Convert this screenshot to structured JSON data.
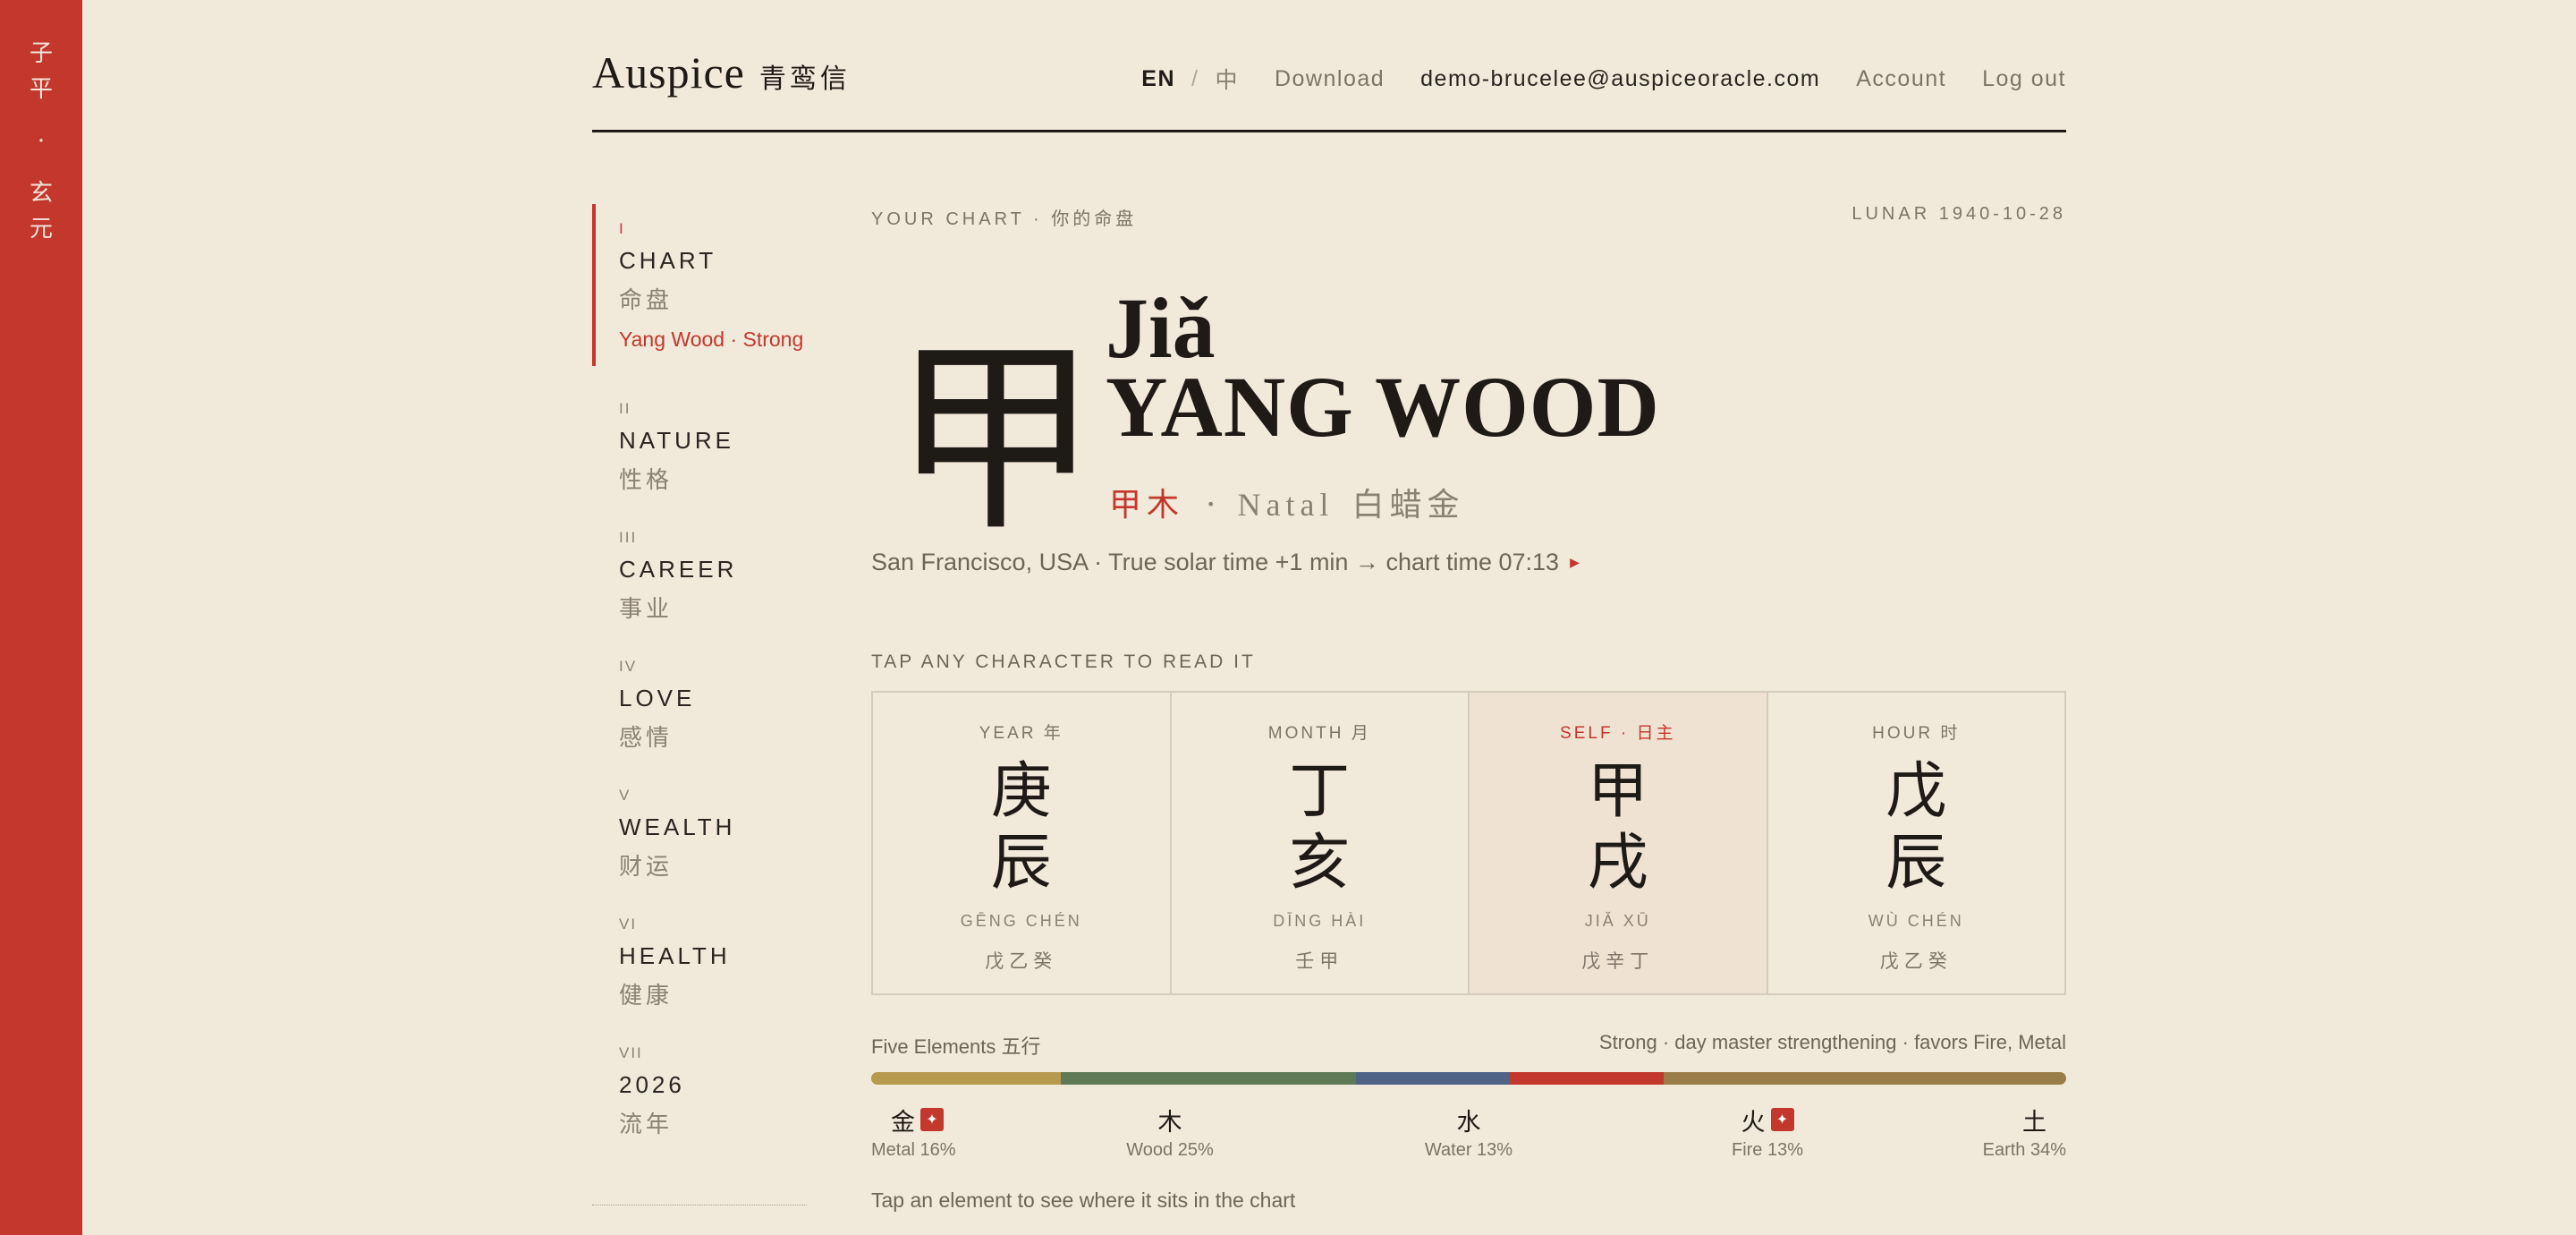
{
  "rail": {
    "chars": [
      "子",
      "平",
      "·",
      "玄",
      "元"
    ]
  },
  "header": {
    "logo_en": "Auspice",
    "logo_zh": "青鸾信",
    "lang_en": "EN",
    "lang_sep": "/",
    "lang_zh": "中",
    "download": "Download",
    "email": "demo-brucelee@auspiceoracle.com",
    "account": "Account",
    "logout": "Log out"
  },
  "sidebar": {
    "items": [
      {
        "num": "I",
        "en": "CHART",
        "zh": "命盘",
        "sub": "Yang Wood · Strong",
        "active": true
      },
      {
        "num": "II",
        "en": "NATURE",
        "zh": "性格"
      },
      {
        "num": "III",
        "en": "CAREER",
        "zh": "事业"
      },
      {
        "num": "IV",
        "en": "LOVE",
        "zh": "感情"
      },
      {
        "num": "V",
        "en": "WEALTH",
        "zh": "财运"
      },
      {
        "num": "VI",
        "en": "HEALTH",
        "zh": "健康"
      },
      {
        "num": "VII",
        "en": "2026",
        "zh": "流年"
      }
    ]
  },
  "main": {
    "eyebrow": "YOUR CHART · 你的命盘",
    "lunar": "LUNAR 1940-10-28",
    "glyph": "甲",
    "pinyin": "Jiǎ",
    "name": "YANG WOOD",
    "element_zh": "甲木",
    "dot": "·",
    "natal": "Natal",
    "natal_zh": "白蜡金",
    "location": "San Francisco, USA · True solar time +1 min → chart time 07:13",
    "tap_label": "TAP ANY CHARACTER TO READ IT",
    "pillars": [
      {
        "label": "YEAR 年",
        "stem": "庚",
        "branch": "辰",
        "pinyin": "GĒNG CHÉN",
        "hidden": "戊乙癸"
      },
      {
        "label": "MONTH 月",
        "stem": "丁",
        "branch": "亥",
        "pinyin": "DĪNG HÀI",
        "hidden": "壬甲"
      },
      {
        "label": "SELF · 日主",
        "stem": "甲",
        "branch": "戌",
        "pinyin": "JIǍ XŪ",
        "hidden": "戊辛丁"
      },
      {
        "label": "HOUR 时",
        "stem": "戊",
        "branch": "辰",
        "pinyin": "WÙ CHÉN",
        "hidden": "戊乙癸"
      }
    ],
    "five_elements_label": "Five Elements 五行",
    "strength_note": "Strong · day master strengthening · favors Fire, Metal",
    "elements": [
      {
        "zh": "金",
        "label": "Metal 16%",
        "pct": 16,
        "color": "#b79a4e",
        "favored": true
      },
      {
        "zh": "木",
        "label": "Wood 25%",
        "pct": 25,
        "color": "#5f7a57",
        "favored": false
      },
      {
        "zh": "水",
        "label": "Water 13%",
        "pct": 13,
        "color": "#4f6386",
        "favored": false
      },
      {
        "zh": "火",
        "label": "Fire 13%",
        "pct": 13,
        "color": "#c4372c",
        "favored": true
      },
      {
        "zh": "土",
        "label": "Earth 34%",
        "pct": 34,
        "color": "#9a7d48",
        "favored": false
      }
    ],
    "hint": "Tap an element to see where it sits in the chart"
  },
  "icons": {
    "favored": "sparkle-icon",
    "location_arrow": "triangle-right-icon"
  },
  "colors": {
    "accent": "#c4372c",
    "background": "#f1e9da",
    "ink": "#1e1a16"
  }
}
